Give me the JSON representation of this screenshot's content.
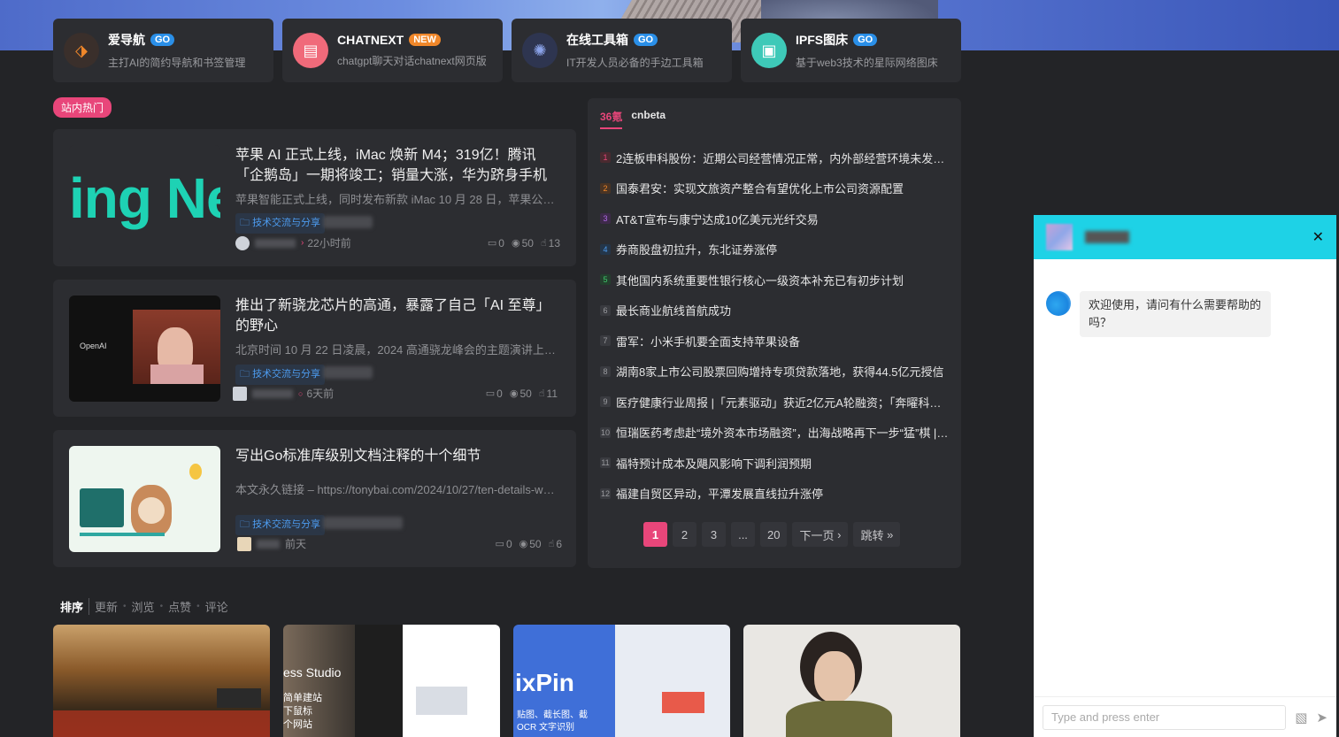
{
  "tiles": [
    {
      "title": "爱导航",
      "badge": "GO",
      "badge_type": "go",
      "desc": "主打AI的简约导航和书签管理",
      "icon": "tag-icon",
      "icon_color": "#3a2f2b"
    },
    {
      "title": "CHATNEXT",
      "badge": "NEW",
      "badge_type": "new",
      "desc": "chatgpt聊天对话chatnext网页版",
      "icon": "chat-icon",
      "icon_color": "#f06a7a"
    },
    {
      "title": "在线工具箱",
      "badge": "GO",
      "badge_type": "go",
      "desc": "IT开发人员必备的手边工具箱",
      "icon": "palette-icon",
      "icon_color": "#2e3550"
    },
    {
      "title": "IPFS图床",
      "badge": "GO",
      "badge_type": "go",
      "desc": "基于web3技术的星际网络图床",
      "icon": "image-icon",
      "icon_color": "#3ec9b8"
    }
  ],
  "hot_label": "站内热门",
  "posts": [
    {
      "title": "苹果 AI 正式上线，iMac 焕新 M4；319亿！腾讯「企鹅岛」一期将竣工；销量大涨，华为跻身手机",
      "excerpt": "苹果智能正式上线，同时发布新款 iMac 10 月 28 日，苹果公司发布",
      "tag": "技术交流与分享",
      "time": "22小时前",
      "comments": "0",
      "views": "50",
      "likes": "13",
      "thumb_text": "ing Ne"
    },
    {
      "title": "推出了新骁龙芯片的高通，暴露了自己「AI 至尊」的野心",
      "excerpt": "北京时间 10 月 22 日凌晨，2024 高通骁龙峰会的主题演讲上，高通",
      "tag": "技术交流与分享",
      "time": "6天前",
      "comments": "0",
      "views": "50",
      "likes": "11",
      "thumb_text": "OpenAI"
    },
    {
      "title": "写出Go标准库级别文档注释的十个细节",
      "excerpt": "本文永久链接 – https://tonybai.com/2024/10/27/ten-details-when-writing-go-doc",
      "tag": "技术交流与分享",
      "time": "前天",
      "comments": "0",
      "views": "50",
      "likes": "6",
      "thumb_text": ""
    }
  ],
  "news": {
    "tabs": [
      "36氪",
      "cnbeta"
    ],
    "items": [
      "2连板申科股份：近期公司经营情况正常，内外部经营环境未发生重大变化",
      "国泰君安：实现文旅资产整合有望优化上市公司资源配置",
      "AT&T宣布与康宁达成10亿美元光纤交易",
      "券商股盘初拉升，东北证券涨停",
      "其他国内系统重要性银行核心一级资本补充已有初步计划",
      "最长商业航线首航成功",
      "雷军：小米手机要全面支持苹果设备",
      "湖南8家上市公司股票回购增持专项贷款落地，获得44.5亿元授信",
      "医疗健康行业周报 |「元素驱动」获近2亿元A轮融资；「奔曜科技」完成融资",
      "恒瑞医药考虑赴“境外资本市场融资”，出海战略再下一步“猛”棋 | 最前线",
      "福特预计成本及飓风影响下调利润预期",
      "福建自贸区异动，平潭发展直线拉升涨停"
    ]
  },
  "pager": {
    "pages": [
      "1",
      "2",
      "3",
      "...",
      "20"
    ],
    "next": "下一页",
    "jump": "跳转"
  },
  "sort": {
    "label": "排序",
    "options": [
      "更新",
      "浏览",
      "点赞",
      "评论"
    ]
  },
  "cards": [
    {
      "title": ""
    },
    {
      "title": "ess Studio",
      "lines": [
        "简单建站",
        "下鼠标",
        "个网站"
      ]
    },
    {
      "title": "ixPin",
      "lines": [
        "贴图、截长图、截",
        "OCR 文字识别"
      ]
    },
    {
      "title": ""
    }
  ],
  "chat": {
    "greeting": "欢迎使用，请问有什么需要帮助的吗？",
    "input_placeholder": "Type and press enter",
    "header_color": "#1ed2e6"
  }
}
